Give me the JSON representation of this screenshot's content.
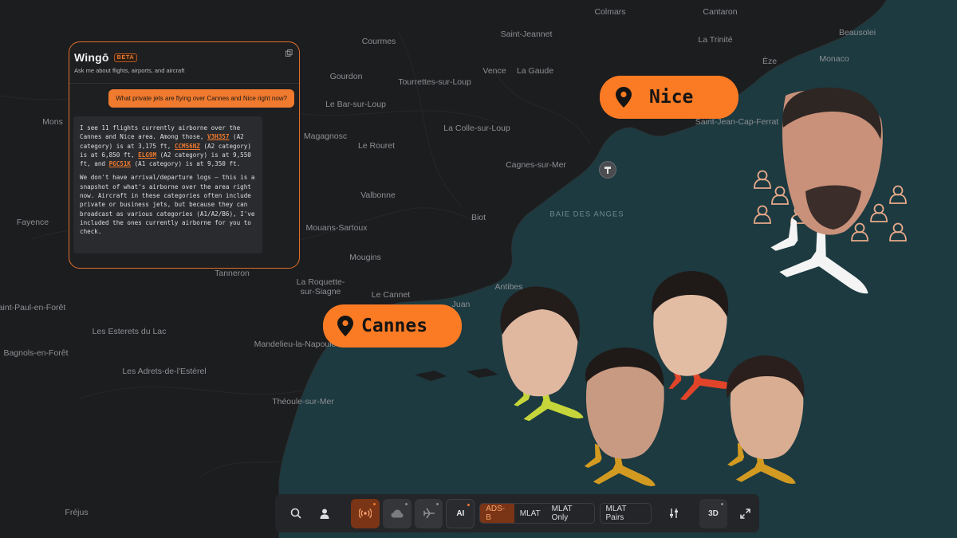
{
  "map": {
    "labels": [
      {
        "id": "colmars",
        "text": "Colmars"
      },
      {
        "id": "cantaron",
        "text": "Cantaron"
      },
      {
        "id": "courmes",
        "text": "Courmes"
      },
      {
        "id": "saint-jeannet",
        "text": "Saint-Jeannet"
      },
      {
        "id": "beausoleil",
        "text": "Beausolei"
      },
      {
        "id": "la-trinite",
        "text": "La Trinité"
      },
      {
        "id": "eze",
        "text": "Èze"
      },
      {
        "id": "monaco",
        "text": "Monaco"
      },
      {
        "id": "vence",
        "text": "Vence"
      },
      {
        "id": "la-gaude",
        "text": "La Gaude"
      },
      {
        "id": "gourdon",
        "text": "Gourdon"
      },
      {
        "id": "tourrettes",
        "text": "Tourrettes-sur-Loup"
      },
      {
        "id": "le-bar",
        "text": "Le Bar-sur-Loup"
      },
      {
        "id": "mons",
        "text": "Mons"
      },
      {
        "id": "st-jean-cap",
        "text": "Saint-Jean-Cap-Ferrat"
      },
      {
        "id": "la-colle",
        "text": "La Colle-sur-Loup"
      },
      {
        "id": "magagnosc",
        "text": "Magagnosc"
      },
      {
        "id": "le-rouret",
        "text": "Le Rouret"
      },
      {
        "id": "cagnes",
        "text": "Cagnes-sur-Mer"
      },
      {
        "id": "valbonne",
        "text": "Valbonne"
      },
      {
        "id": "baie",
        "text": "BAIE DES ANGES"
      },
      {
        "id": "fayence",
        "text": "Fayence"
      },
      {
        "id": "biot",
        "text": "Biot"
      },
      {
        "id": "mouans",
        "text": "Mouans-Sartoux"
      },
      {
        "id": "mougins",
        "text": "Mougins"
      },
      {
        "id": "tanneron",
        "text": "Tanneron"
      },
      {
        "id": "la-roquette",
        "text": "La Roquette-"
      },
      {
        "id": "la-roquette2",
        "text": "sur-Siagne"
      },
      {
        "id": "antibes",
        "text": "Antibes"
      },
      {
        "id": "le-cannet",
        "text": "Le Cannet"
      },
      {
        "id": "juan",
        "text": "Juan"
      },
      {
        "id": "st-paul",
        "text": "aint-Paul-en-Forêt"
      },
      {
        "id": "esterets",
        "text": "Les Esterets du Lac"
      },
      {
        "id": "mandelieu",
        "text": "Mandelieu-la-Napoule"
      },
      {
        "id": "bagnols",
        "text": "Bagnols-en-Forêt"
      },
      {
        "id": "adrets",
        "text": "Les Adrets-de-l'Estérel"
      },
      {
        "id": "theoule",
        "text": "Théoule-sur-Mer"
      },
      {
        "id": "frejus",
        "text": "Fréjus"
      }
    ]
  },
  "chat": {
    "title": "Wingō",
    "badge": "BETA",
    "subtitle": "Ask me about flights, airports, and aircraft",
    "user_message": "What private jets are flying over Cannes and Nice right now?",
    "reply": {
      "p1_a": "I see 11 flights currently airborne over the Cannes and Nice area. Among those, ",
      "f1": "V3H357",
      "p1_b": " (A2 category) is at 3,175 ft, ",
      "f2": "CCM56NZ",
      "p1_c": " (A2 category) is at 6,850 ft, ",
      "f3": "ELG9M",
      "p1_d": " (A2 category) is at 9,550 ft, and ",
      "f4": "PGC51K",
      "p1_e": " (A1 category) is at 9,350 ft.",
      "p2": "We don't have arrival/departure logs — this is a snapshot of what's airborne over the area right now. Aircraft in these categories often include private or business jets, but because they can broadcast as various categories (A1/A2/B6), I've included the ones currently airborne for you to check."
    }
  },
  "pins": {
    "nice": "Nice",
    "cannes": "Cannes"
  },
  "toolbar": {
    "ai_label": "AI",
    "modes": [
      "ADS-B",
      "MLAT",
      "MLAT Only"
    ],
    "active_mode": "ADS-B",
    "mlat_pairs": "MLAT Pairs",
    "three_d": "3D"
  },
  "colors": {
    "accent": "#fb7b24",
    "sea": "#1c3a40",
    "land": "#1c1d1f"
  }
}
